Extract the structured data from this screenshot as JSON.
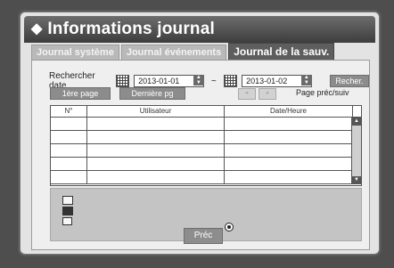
{
  "window": {
    "title": "Informations journal"
  },
  "tabs": [
    {
      "label": "Journal système",
      "active": false
    },
    {
      "label": "Journal événements",
      "active": false
    },
    {
      "label": "Journal de la sauv.",
      "active": true
    }
  ],
  "search": {
    "label": "Rechercher date",
    "start_date": "2013-01-01",
    "separator": "~",
    "end_date": "2013-01-02",
    "button": "Recher."
  },
  "paging": {
    "first_page": "1ère page",
    "last_page": "Dernière pg",
    "prev_icon": "«",
    "next_icon": "»",
    "label": "Page préc/suiv"
  },
  "table": {
    "columns": [
      "N°",
      "Utilisateur",
      "Date/Heure"
    ],
    "rows": [
      [
        "",
        "",
        ""
      ],
      [
        "",
        "",
        ""
      ],
      [
        "",
        "",
        ""
      ],
      [
        "",
        "",
        ""
      ],
      [
        "",
        "",
        ""
      ]
    ]
  },
  "footer": {
    "prev_button": "Préc"
  },
  "colors": {
    "background": "#4e4e4e",
    "panel": "#e3e3e3",
    "title_bar": "#4a4a4a",
    "active_tab": "#5e5e5e"
  }
}
